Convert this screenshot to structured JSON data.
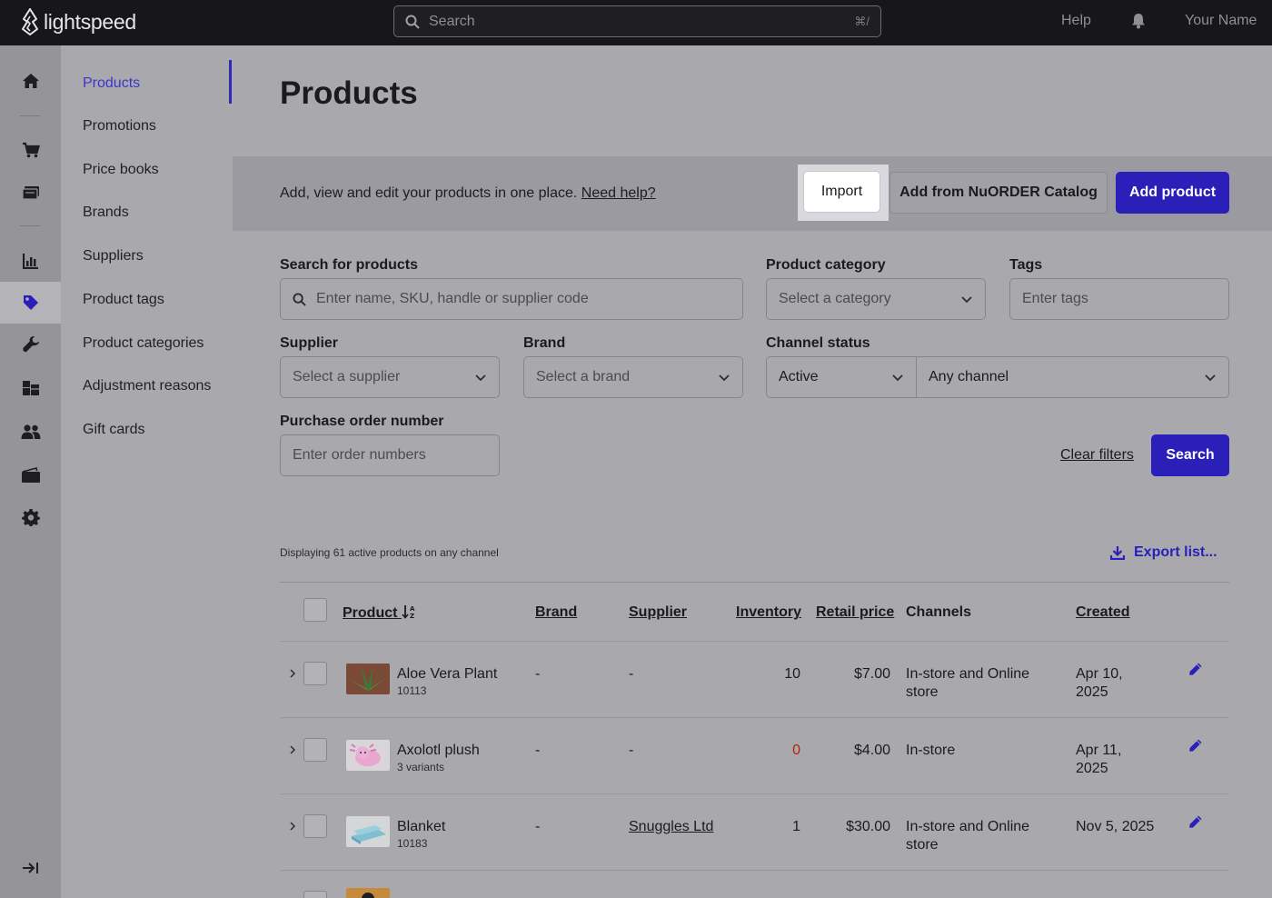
{
  "topbar": {
    "brand": "lightspeed",
    "search_placeholder": "Search",
    "shortcut": "⌘/",
    "help": "Help",
    "user": "Your Name"
  },
  "rail": {
    "icons": [
      "home-icon",
      "cart-icon",
      "register-icon",
      "reports-icon",
      "tag-icon",
      "wrench-icon",
      "inventory-icon",
      "customers-icon",
      "wallet-icon",
      "settings-icon",
      "expand-icon"
    ]
  },
  "subnav": {
    "items": [
      {
        "label": "Products"
      },
      {
        "label": "Promotions"
      },
      {
        "label": "Price books"
      },
      {
        "label": "Brands"
      },
      {
        "label": "Suppliers"
      },
      {
        "label": "Product tags"
      },
      {
        "label": "Product categories"
      },
      {
        "label": "Adjustment reasons"
      },
      {
        "label": "Gift cards"
      }
    ]
  },
  "page": {
    "title": "Products",
    "banner_text": "Add, view and edit your products in one place.",
    "banner_link": "Need help?",
    "import_label": "Import",
    "nuorder_label": "Add from NuORDER Catalog",
    "add_label": "Add product"
  },
  "filters": {
    "search_label": "Search for products",
    "search_placeholder": "Enter name, SKU, handle or supplier code",
    "category_label": "Product category",
    "category_value": "Select a category",
    "tags_label": "Tags",
    "tags_placeholder": "Enter tags",
    "supplier_label": "Supplier",
    "supplier_value": "Select a supplier",
    "brand_label": "Brand",
    "brand_value": "Select a brand",
    "channel_label": "Channel status",
    "status_value": "Active",
    "channel_value": "Any channel",
    "po_label": "Purchase order number",
    "po_placeholder": "Enter order numbers",
    "clear_label": "Clear filters",
    "search_button": "Search"
  },
  "list": {
    "count_text": "Displaying 61 active products on any channel",
    "export_label": "Export list...",
    "headers": {
      "product": "Product",
      "brand": "Brand",
      "supplier": "Supplier",
      "inventory": "Inventory",
      "retail": "Retail price",
      "channels": "Channels",
      "created": "Created"
    },
    "rows": [
      {
        "name": "Aloe Vera Plant",
        "sub": "10113",
        "brand": "-",
        "supplier": "-",
        "inventory": "10",
        "price": "$7.00",
        "channels_1": "In-store and Online",
        "channels_2": "store",
        "created_1": "Apr 10,",
        "created_2": "2025"
      },
      {
        "name": "Axolotl plush",
        "sub": "3 variants",
        "brand": "-",
        "supplier": "-",
        "inventory": "0",
        "price": "$4.00",
        "channels_1": "In-store",
        "channels_2": "",
        "created_1": "Apr 11,",
        "created_2": "2025"
      },
      {
        "name": "Blanket",
        "sub": "10183",
        "brand": "-",
        "supplier": "Snuggles Ltd",
        "inventory": "1",
        "price": "$30.00",
        "channels_1": "In-store and Online",
        "channels_2": "store",
        "created_1": "Nov 5, 2025",
        "created_2": ""
      }
    ],
    "zero_color": "#b2230f",
    "accent": "#2a1fb8"
  }
}
